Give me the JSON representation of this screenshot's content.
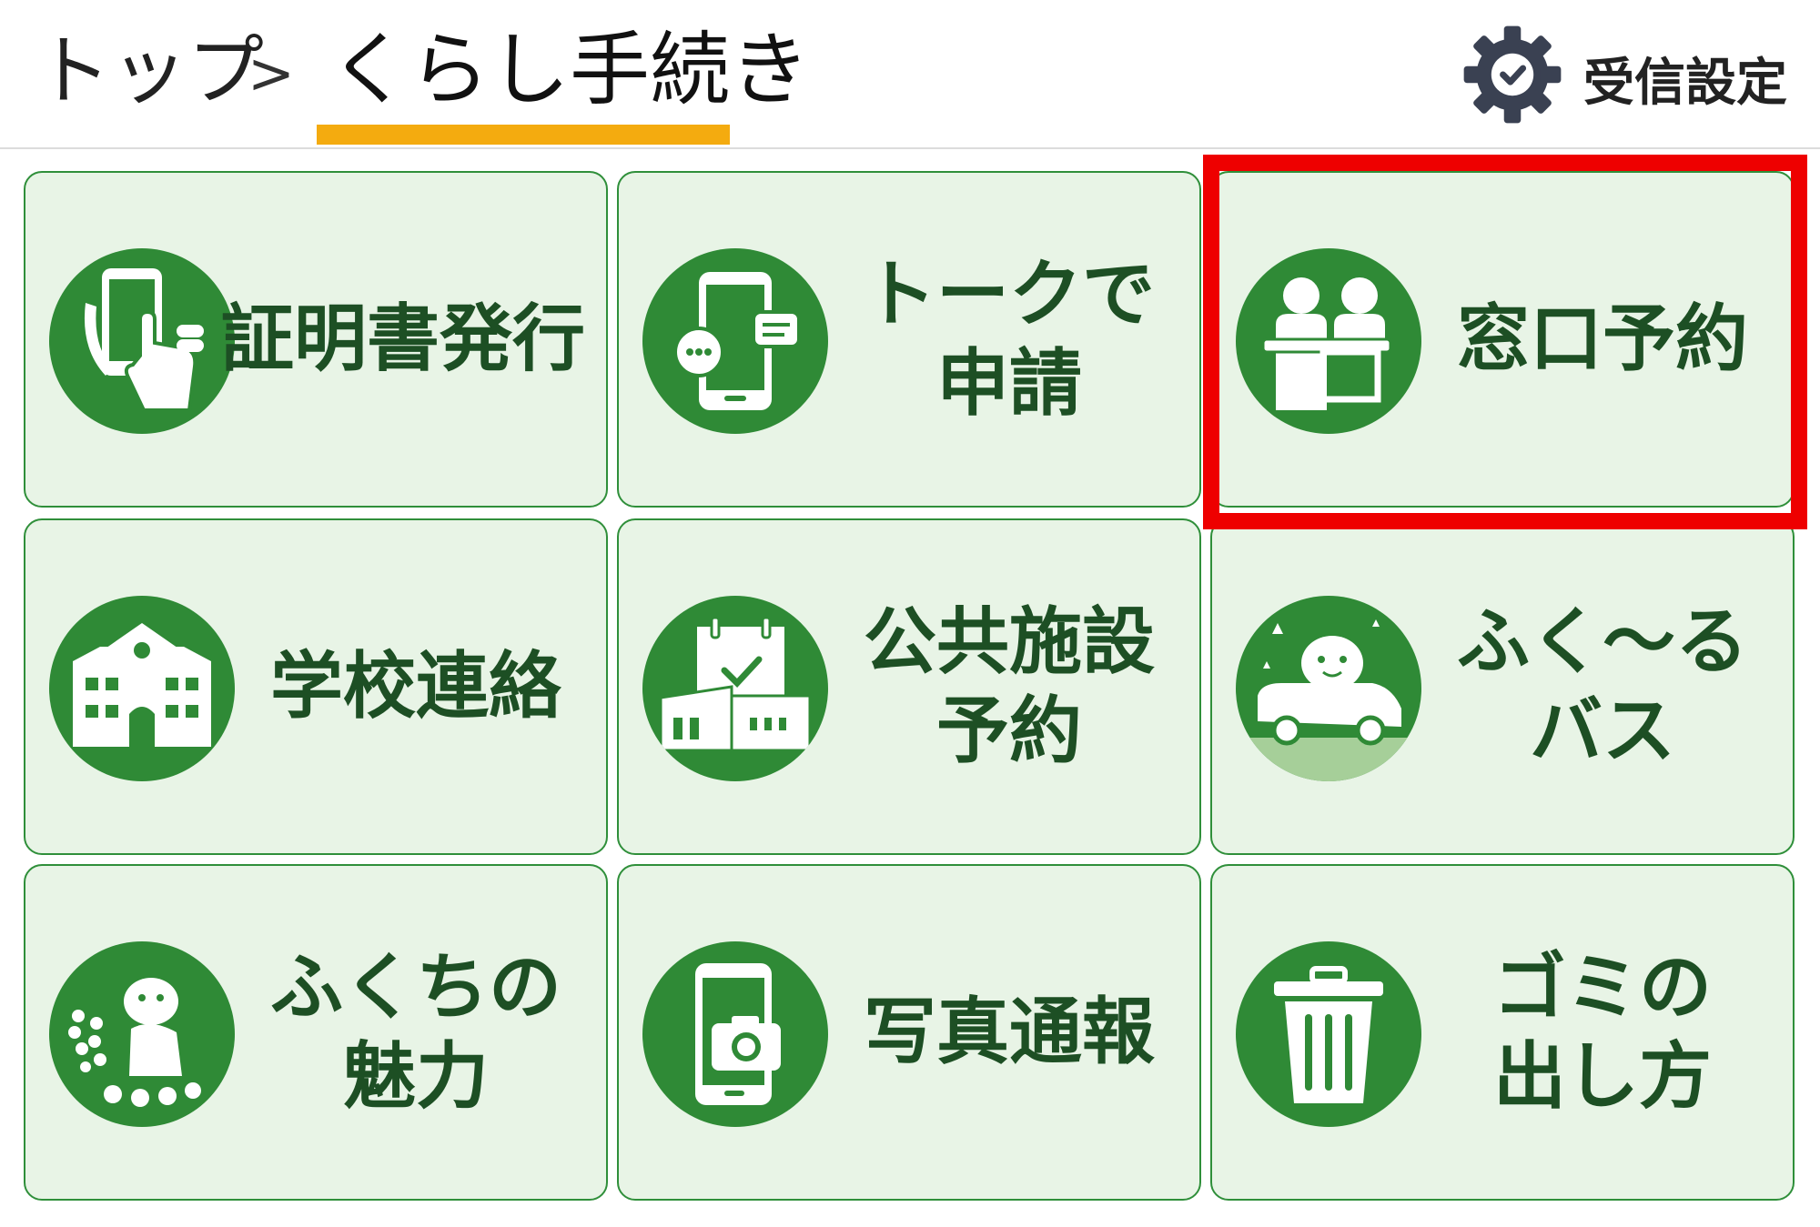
{
  "breadcrumb": {
    "top": "トップ",
    "separator": ">",
    "current": "くらし手続き"
  },
  "settings": {
    "label": "受信設定",
    "icon": "gear-check-icon"
  },
  "colors": {
    "tile_background": "#e8f4e6",
    "tile_border": "#2f8f3a",
    "icon_circle": "#2f8a36",
    "label_text": "#1d4f24",
    "tab_underline": "#f4ab0f",
    "highlight": "#ee0000"
  },
  "tiles": [
    {
      "lines": [
        "証明書発行"
      ],
      "icon": "smartphone-tap-icon"
    },
    {
      "lines": [
        "トークで",
        "申請"
      ],
      "icon": "chat-phone-icon"
    },
    {
      "lines": [
        "窓口予約"
      ],
      "icon": "counter-reception-icon"
    },
    {
      "lines": [
        "学校連絡"
      ],
      "icon": "school-building-icon"
    },
    {
      "lines": [
        "公共施設",
        "予約"
      ],
      "icon": "facility-calendar-icon"
    },
    {
      "lines": [
        "ふく〜る",
        "バス"
      ],
      "icon": "mascot-bus-icon"
    },
    {
      "lines": [
        "ふくちの",
        "魅力"
      ],
      "icon": "mascot-flowers-icon"
    },
    {
      "lines": [
        "写真通報"
      ],
      "icon": "camera-phone-icon"
    },
    {
      "lines": [
        "ゴミの",
        "出し方"
      ],
      "icon": "trash-can-icon"
    }
  ],
  "highlighted_tile": "窓口予約"
}
